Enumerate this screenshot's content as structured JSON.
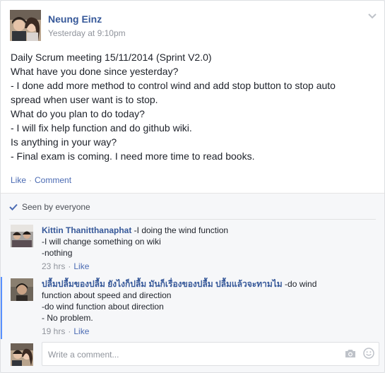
{
  "post": {
    "author": "Neung Einz",
    "time": "Yesterday at 9:10pm",
    "lines": [
      "Daily Scrum meeting 15/11/2014 (Sprint V2.0)",
      "What have you done since yesterday?",
      "- I done add more method to control wind and add stop button to stop auto",
      "spread when user want is to stop.",
      "What do you plan to do today?",
      "- I will fix help function and do github wiki.",
      "Is anything in your way?",
      "- Final exam is coming. I need more time to read books."
    ],
    "actions": {
      "like": "Like",
      "comment": "Comment"
    }
  },
  "seen": "Seen by everyone",
  "comments": [
    {
      "author": "Kittin Thanitthanaphat",
      "lines": [
        "-I doing the wind function",
        "-I will change something on wiki",
        "-nothing"
      ],
      "time": "23 hrs",
      "like": "Like"
    },
    {
      "author": "ปลื้มปลื้มของปลื้ม ยังไงก็ปลื้ม มันก็เรื่องของปลื้ม ปลื้มแล้วจะทามไม",
      "lines": [
        "-do wind",
        "function about speed and direction",
        "-do wind function about direction",
        "- No problem."
      ],
      "time": "19 hrs",
      "like": "Like"
    }
  ],
  "composer": {
    "placeholder": "Write a comment..."
  },
  "icons": {
    "options": "chevron-down-icon",
    "seen": "check-icon",
    "camera": "camera-icon",
    "emoji": "smiley-icon"
  },
  "colors": {
    "link": "#365899",
    "action": "#4b6bb3",
    "meta": "#90949c",
    "new_comment_bar": "#5890ff"
  }
}
